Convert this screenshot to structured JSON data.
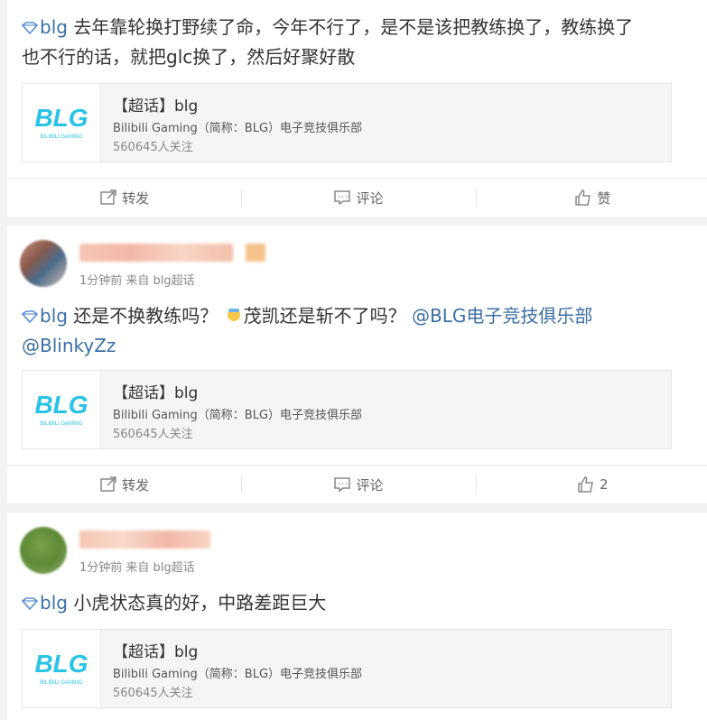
{
  "posts": [
    {
      "topic_tag": "blg",
      "text": "去年靠轮换打野续了命，今年不行了，是不是该把教练换了，教练换了",
      "text_line2": "也不行的话，就把glc换了，然后好聚好散",
      "card": {
        "title": "【超话】blg",
        "desc": "Bilibili Gaming（简称：BLG）电子竞技俱乐部",
        "count": "560645人关注"
      },
      "actions": {
        "repost": "转发",
        "comment": "评论",
        "like": "赞"
      }
    },
    {
      "meta": "1分钟前 来自 blg超话",
      "topic_tag": "blg",
      "text_a": "还是不换教练吗？",
      "text_b": "茂凯还是斩不了吗？",
      "mention1": "@BLG电子竞技俱乐部",
      "mention2": "@BlinkyZz",
      "card": {
        "title": "【超话】blg",
        "desc": "Bilibili Gaming（简称：BLG）电子竞技俱乐部",
        "count": "560645人关注"
      },
      "actions": {
        "repost": "转发",
        "comment": "评论",
        "like": "2"
      }
    },
    {
      "meta": "1分钟前 来自 blg超话",
      "topic_tag": "blg",
      "text": "小虎状态真的好，中路差距巨大",
      "card": {
        "title": "【超话】blg",
        "desc": "Bilibili Gaming（简称：BLG）电子竞技俱乐部",
        "count": "560645人关注"
      }
    }
  ],
  "logo_text": {
    "big": "BLG",
    "small": "BILIBILI GAMING"
  },
  "colors": {
    "link": "#3b6ea5",
    "logo_cyan": "#29c3e6",
    "logo_pink": "#f47aa0"
  }
}
